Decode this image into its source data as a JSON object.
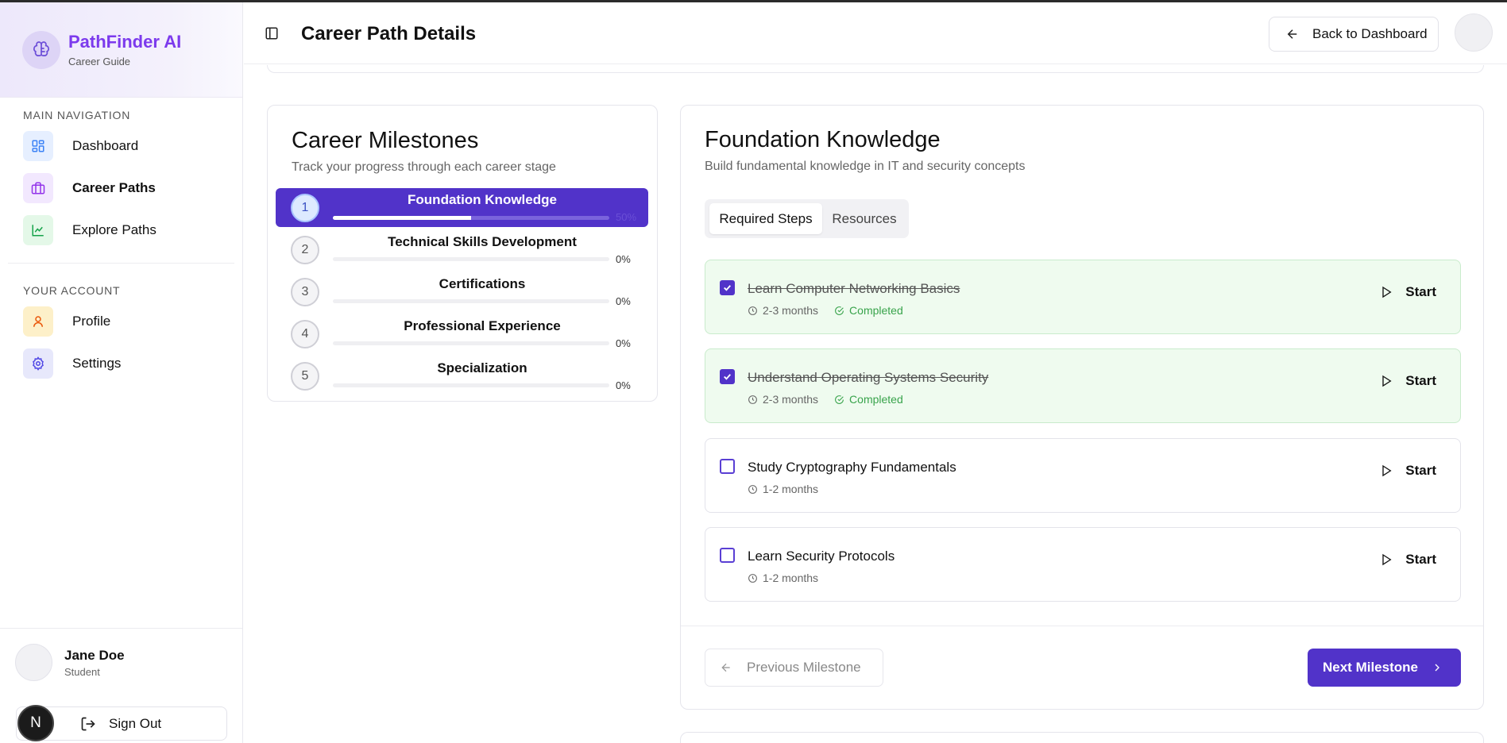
{
  "brand": {
    "title": "PathFinder AI",
    "subtitle": "Career Guide"
  },
  "nav": {
    "main_heading": "MAIN NAVIGATION",
    "main_items": [
      {
        "label": "Dashboard",
        "icon": "dashboard-icon",
        "color": "#3b82f6"
      },
      {
        "label": "Career Paths",
        "icon": "briefcase-icon",
        "color": "#9333ea",
        "active": true
      },
      {
        "label": "Explore Paths",
        "icon": "chart-line-icon",
        "color": "#16a34a"
      }
    ],
    "account_heading": "YOUR ACCOUNT",
    "account_items": [
      {
        "label": "Profile",
        "icon": "user-icon",
        "color": "#ea580c"
      },
      {
        "label": "Settings",
        "icon": "gear-icon",
        "color": "#4f46e5"
      }
    ]
  },
  "user": {
    "name": "Jane Doe",
    "role": "Student",
    "signout_label": "Sign Out",
    "badge": "N"
  },
  "header": {
    "title": "Career Path Details",
    "back_label": "Back to Dashboard"
  },
  "milestones": {
    "title": "Career Milestones",
    "subtitle": "Track your progress through each career stage",
    "items": [
      {
        "num": "1",
        "name": "Foundation Knowledge",
        "progress": 50,
        "pct": "50%",
        "active": true
      },
      {
        "num": "2",
        "name": "Technical Skills Development",
        "progress": 0,
        "pct": "0%"
      },
      {
        "num": "3",
        "name": "Certifications",
        "progress": 0,
        "pct": "0%"
      },
      {
        "num": "4",
        "name": "Professional Experience",
        "progress": 0,
        "pct": "0%"
      },
      {
        "num": "5",
        "name": "Specialization",
        "progress": 0,
        "pct": "0%"
      }
    ]
  },
  "detail": {
    "title": "Foundation Knowledge",
    "subtitle": "Build fundamental knowledge in IT and security concepts",
    "tabs": [
      "Required Steps",
      "Resources"
    ],
    "steps": [
      {
        "name": "Learn Computer Networking Basics",
        "duration": "2-3 months",
        "status": "Completed",
        "checked": true,
        "action": "Start"
      },
      {
        "name": "Understand Operating Systems Security",
        "duration": "2-3 months",
        "status": "Completed",
        "checked": true,
        "action": "Start"
      },
      {
        "name": "Study Cryptography Fundamentals",
        "duration": "1-2 months",
        "checked": false,
        "action": "Start"
      },
      {
        "name": "Learn Security Protocols",
        "duration": "1-2 months",
        "checked": false,
        "action": "Start"
      }
    ],
    "prev_label": "Previous Milestone",
    "next_label": "Next Milestone"
  },
  "colors": {
    "accent": "#5133c9",
    "brand": "#7c3aed",
    "success": "#38a34b"
  }
}
